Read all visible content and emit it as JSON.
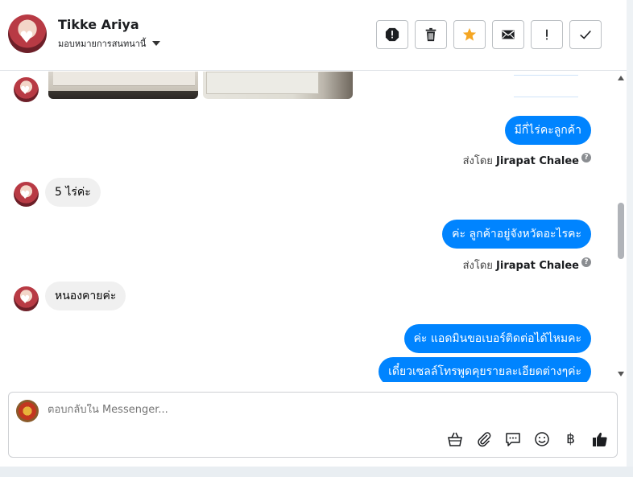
{
  "header": {
    "name": "Tikke Ariya",
    "subtitle": "มอบหมายการสนทนานี้",
    "toolbar": [
      "spam-icon",
      "trash-icon",
      "star-icon",
      "mail-icon",
      "exclamation-icon",
      "check-icon"
    ],
    "accent_star": "#f5a623"
  },
  "messages": [
    {
      "side": "out",
      "text": "มีกี่ไร่คะลูกค้า"
    },
    {
      "side": "meta",
      "prefix": "ส่งโดย",
      "agent": "Jirapat Chalee"
    },
    {
      "side": "in",
      "text": "5 ไร่ค่ะ"
    },
    {
      "side": "out",
      "text": "ค่ะ ลูกค้าอยู่จังหวัดอะไรคะ"
    },
    {
      "side": "meta",
      "prefix": "ส่งโดย",
      "agent": "Jirapat Chalee"
    },
    {
      "side": "in",
      "text": "หนองคายค่ะ"
    },
    {
      "side": "out",
      "text": "ค่ะ แอดมินขอเบอร์ติดต่อได้ไหมคะ"
    },
    {
      "side": "out",
      "text": "เดี๋ยวเซลล์โทรพูดคุยรายละเอียดต่างๆค่ะ"
    }
  ],
  "composer": {
    "placeholder": "ตอบกลับใน Messenger...",
    "tools": [
      "bag-icon",
      "paperclip-icon",
      "speech-icon",
      "emoji-icon",
      "baht-icon",
      "thumbs-up-icon"
    ],
    "baht_symbol": "฿"
  },
  "colors": {
    "bubble_out": "#0084ff",
    "bubble_in": "#f0f0f0"
  }
}
